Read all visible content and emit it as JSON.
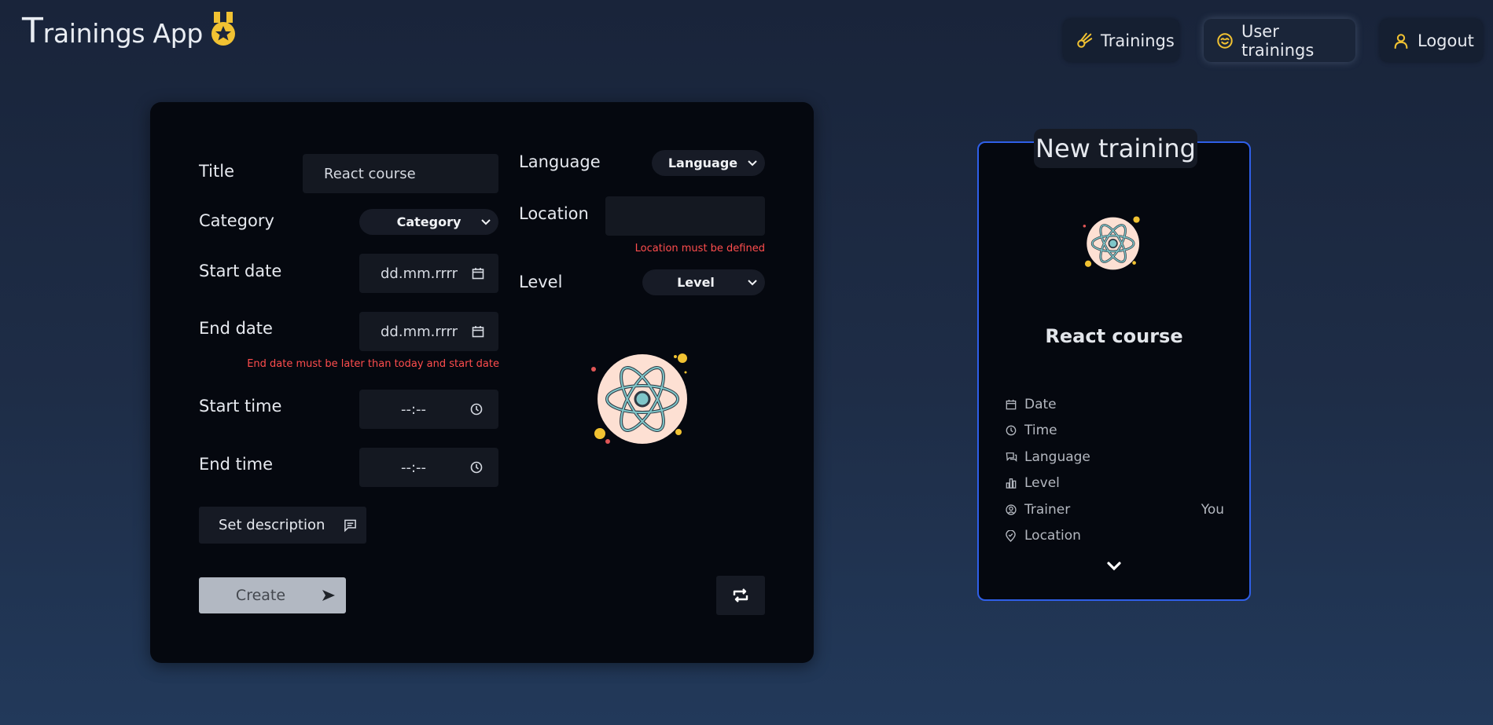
{
  "app": {
    "title_first_letter": "T",
    "title_rest": "rainings App",
    "accent_color": "#f1c232",
    "logo_icon": "medal-icon"
  },
  "nav": {
    "trainings": {
      "label": "Trainings",
      "icon": "comet-icon"
    },
    "user_trainings": {
      "label": "User trainings",
      "icon": "face-icon"
    },
    "logout": {
      "label": "Logout",
      "icon": "user-icon"
    }
  },
  "form": {
    "title_label": "Title",
    "title_value": "React course",
    "category_label": "Category",
    "category_selected": "Category",
    "start_date_label": "Start date",
    "start_date_value": "dd.mm.rrrr",
    "end_date_label": "End date",
    "end_date_value": "dd.mm.rrrr",
    "end_date_error": "End date must be later than today and start date",
    "start_time_label": "Start time",
    "start_time_value": "--:--",
    "end_time_label": "End time",
    "end_time_value": "--:--",
    "language_label": "Language",
    "language_selected": "Language",
    "location_label": "Location",
    "location_value": "",
    "location_error": "Location must be defined",
    "level_label": "Level",
    "level_selected": "Level",
    "set_description_label": "Set description",
    "create_label": "Create",
    "error_color": "#ff4d4d"
  },
  "preview": {
    "heading": "New training",
    "training_name": "React course",
    "border_color": "#2f5fe8",
    "rows": [
      {
        "label": "Date",
        "icon": "calendar-icon",
        "value": ""
      },
      {
        "label": "Time",
        "icon": "clock-icon",
        "value": ""
      },
      {
        "label": "Language",
        "icon": "chat-icon",
        "value": ""
      },
      {
        "label": "Level",
        "icon": "bar-chart-icon",
        "value": ""
      },
      {
        "label": "Trainer",
        "icon": "user-circle-icon",
        "value": "You"
      },
      {
        "label": "Location",
        "icon": "map-pin-icon",
        "value": ""
      }
    ]
  }
}
